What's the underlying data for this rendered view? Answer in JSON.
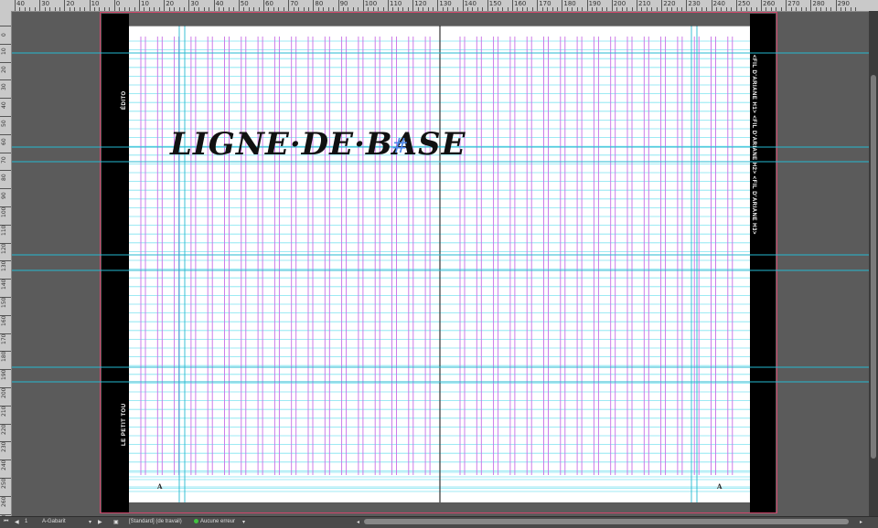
{
  "ruler": {
    "top_labels": [
      "40",
      "30",
      "20",
      "10",
      "0",
      "10",
      "20",
      "30",
      "40",
      "50",
      "60",
      "70",
      "80",
      "90",
      "100",
      "110",
      "120",
      "130",
      "140",
      "150",
      "160",
      "170",
      "180",
      "190",
      "200",
      "210",
      "220",
      "230",
      "240",
      "250",
      "260",
      "270",
      "280",
      "290"
    ],
    "left_labels": [
      "0",
      "10",
      "20",
      "30",
      "40",
      "50",
      "60",
      "70",
      "80",
      "90",
      "100",
      "110",
      "120",
      "130",
      "140",
      "150",
      "160",
      "170",
      "180",
      "190",
      "200",
      "210",
      "220",
      "230",
      "240",
      "250",
      "260",
      "270",
      "280"
    ]
  },
  "document": {
    "left_spine_top_text": "ÉDITO",
    "left_spine_bottom_text": "LE PETIT TOU",
    "right_spine_text": "<FIL D'ARIANE H1> <FIL D'ARIANE H2> <FIL D'ARIANE H3>",
    "headline": "LIGNE·DE·BASE",
    "headline_mark": "#",
    "page_marker_left": "A",
    "page_marker_right": "A"
  },
  "statusbar": {
    "page_number": "1",
    "master": "A-Gabarit",
    "profile": "[Standard] (de travail)",
    "preflight": "Aucune erreur"
  },
  "colors": {
    "pasteboard": "#5b5b5b",
    "baseline_grid": "#7fe3f0",
    "column_guides": "#c86ee6",
    "guides": "#25b9d0",
    "bleed": "#d0466b",
    "headline_mark": "#4a86e8"
  }
}
